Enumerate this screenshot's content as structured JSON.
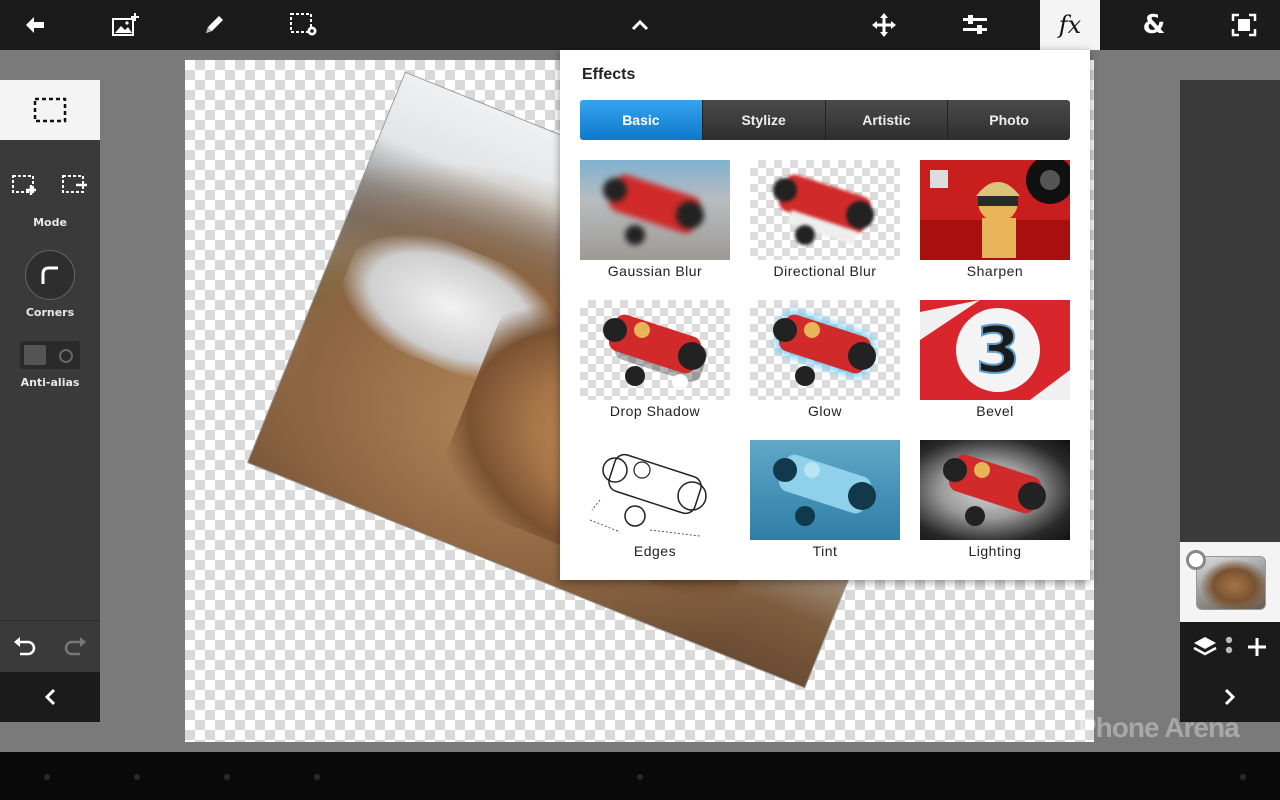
{
  "toolbar": {
    "items": [
      "back-icon",
      "add-image-icon",
      "pencil-icon",
      "selection-settings-icon",
      "collapse-up-icon",
      "move-icon",
      "adjustments-icon",
      "fx-icon",
      "text-icon",
      "fit-screen-icon"
    ],
    "fx_label": "fx",
    "text_label": "&"
  },
  "left_panel": {
    "mode_label": "Mode",
    "corners_label": "Corners",
    "antialias_label": "Anti-alias"
  },
  "effects": {
    "title": "Effects",
    "tabs": [
      {
        "label": "Basic",
        "active": true
      },
      {
        "label": "Stylize",
        "active": false
      },
      {
        "label": "Artistic",
        "active": false
      },
      {
        "label": "Photo",
        "active": false
      }
    ],
    "tiles": [
      {
        "label": "Gaussian Blur"
      },
      {
        "label": "Directional Blur"
      },
      {
        "label": "Sharpen"
      },
      {
        "label": "Drop Shadow"
      },
      {
        "label": "Glow"
      },
      {
        "label": "Bevel"
      },
      {
        "label": "Edges"
      },
      {
        "label": "Tint"
      },
      {
        "label": "Lighting"
      }
    ]
  },
  "watermark": "Phone Arena",
  "colors": {
    "accent": "#1a8ee0",
    "toolbar": "#1b1b1b",
    "panel": "#3a3a3a"
  }
}
